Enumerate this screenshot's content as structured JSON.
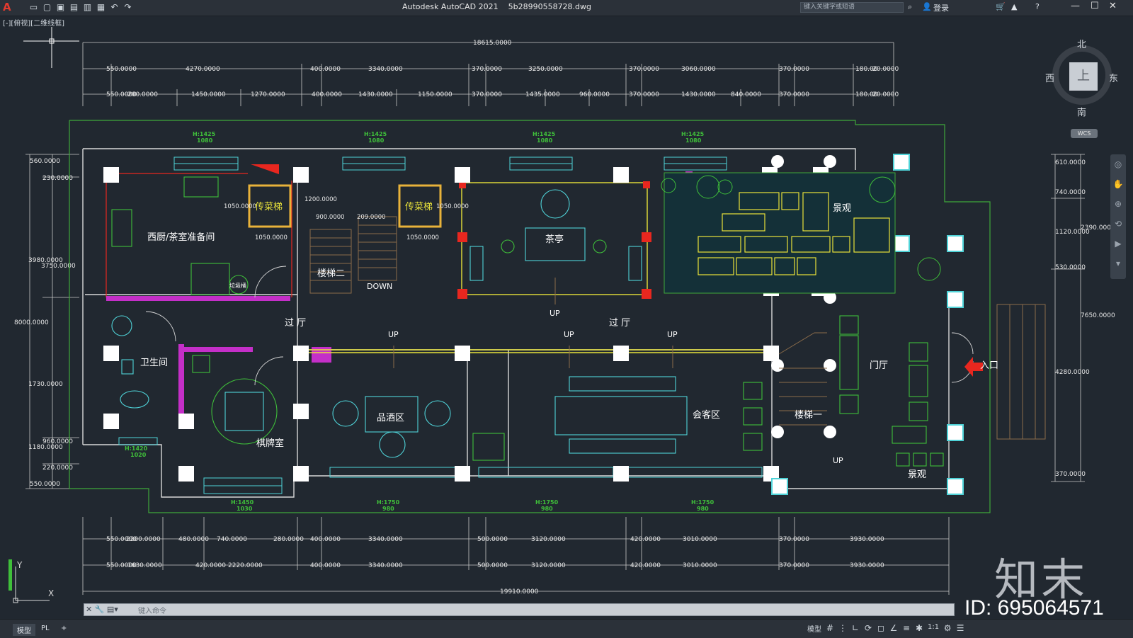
{
  "app": {
    "title": "Autodesk AutoCAD 2021",
    "filename": "5b28990558728.dwg",
    "view_label": "[-][俯视][二维线框]",
    "search_placeholder": "键入关键字或短语",
    "login_label": "登录"
  },
  "icons": [
    "application-menu-icon",
    "new-icon",
    "open-icon",
    "save-icon",
    "save-as-icon",
    "plot-icon",
    "print-icon",
    "undo-icon",
    "redo-icon",
    "search-icon",
    "user-icon",
    "cart-icon",
    "share-icon",
    "help-icon",
    "minimize-icon",
    "maximize-icon",
    "close-icon"
  ],
  "viewcube": {
    "north": "北",
    "south": "南",
    "east": "东",
    "west": "西",
    "face": "上",
    "wcs": "WCS"
  },
  "dimensions": {
    "overall_top": "18615.0000",
    "overall_bottom": "19910.0000",
    "top_row1": [
      "550.0000",
      "4270.0000",
      "400.0000",
      "3340.0000",
      "370.0000",
      "3250.0000",
      "370.0000",
      "3060.0000",
      "370.0000",
      "180.00",
      "20.0000"
    ],
    "top_row2": [
      "550.0000",
      "200.0000",
      "1450.0000",
      "1270.0000",
      "400.0000",
      "1430.0000",
      "1150.0000",
      "370.0000",
      "1435.0000",
      "960.0000",
      "370.0000",
      "1430.0000",
      "840.0000",
      "370.0000",
      "180.00",
      "20.0000"
    ],
    "bottom_row1": [
      "550.0000",
      "2200.0000",
      "480.0000",
      "740.0000",
      "280.0000",
      "400.0000",
      "3340.0000",
      "500.0000",
      "3120.0000",
      "420.0000",
      "3010.0000",
      "370.0000",
      "3930.0000"
    ],
    "bottom_row2": [
      "550.0000",
      "1630.0000",
      "420.0000",
      "2220.0000",
      "400.0000",
      "3340.0000",
      "500.0000",
      "3120.0000",
      "420.0000",
      "3010.0000",
      "370.0000",
      "3930.0000"
    ],
    "left": [
      "560.0000",
      "230.0000",
      "3980.0000",
      "3750.0000",
      "8000.0000",
      "1730.0000",
      "1180.0000",
      "960.0000",
      "220.0000",
      "550.0000"
    ],
    "right": [
      "610.0000",
      "740.0000",
      "2390.0000",
      "1120.0000",
      "530.0000",
      "7650.0000",
      "4280.0000",
      "370.0000"
    ],
    "stairs": [
      "1050.0000",
      "1200.0000",
      "900.0000",
      "209.0000",
      "1050.0000",
      "1050.0000",
      "1050.0000"
    ],
    "windows_top": [
      "H:1425",
      "1080",
      "H:1425",
      "1080",
      "H:1425",
      "1080",
      "H:1425",
      "1080"
    ],
    "windows_bottom": [
      "H:1450",
      "1030",
      "H:1750",
      "980",
      "H:1750",
      "980",
      "H:1750",
      "980"
    ],
    "windows_left": [
      "H:1420",
      "1020"
    ]
  },
  "rooms": {
    "kitchen": "西厨/茶室准备间",
    "dumbwaiter1": "传菜梯",
    "dumbwaiter2": "传菜梯",
    "stair2": "楼梯二",
    "down": "DOWN",
    "tea_pavilion": "茶亭",
    "landscape_top": "景观",
    "hall_left": "过 厅",
    "hall_right": "过 厅",
    "up1": "UP",
    "up2": "UP",
    "up3": "UP",
    "up4": "UP",
    "up5": "UP",
    "restroom": "卫生间",
    "chess_room": "棋牌室",
    "wine_area": "品酒区",
    "reception": "会客区",
    "stair1": "楼梯一",
    "foyer": "门厅",
    "entrance": "入口",
    "landscape_bottom": "景观",
    "trash": "垃圾桶"
  },
  "command_line": {
    "placeholder": "键入命令"
  },
  "status": {
    "tab_model": "模型",
    "tab_layout": "PL",
    "tab_add": "+",
    "mode_label": "模型",
    "scale": "1:1",
    "icons": [
      "grid-icon",
      "snap-icon",
      "ortho-icon",
      "polar-icon",
      "osnap-icon",
      "otrack-icon",
      "lineweight-icon",
      "annotation-icon",
      "workspace-icon",
      "customize-icon"
    ]
  },
  "watermark": {
    "logo": "知末",
    "id": "ID: 695064571"
  },
  "colors": {
    "background": "#212830",
    "wall": "#ffffff",
    "outline_green": "#3fa73a",
    "yellow": "#e8e23a",
    "cyan": "#4fd3d8",
    "magenta": "#c42fc8",
    "red": "#e8271f"
  }
}
